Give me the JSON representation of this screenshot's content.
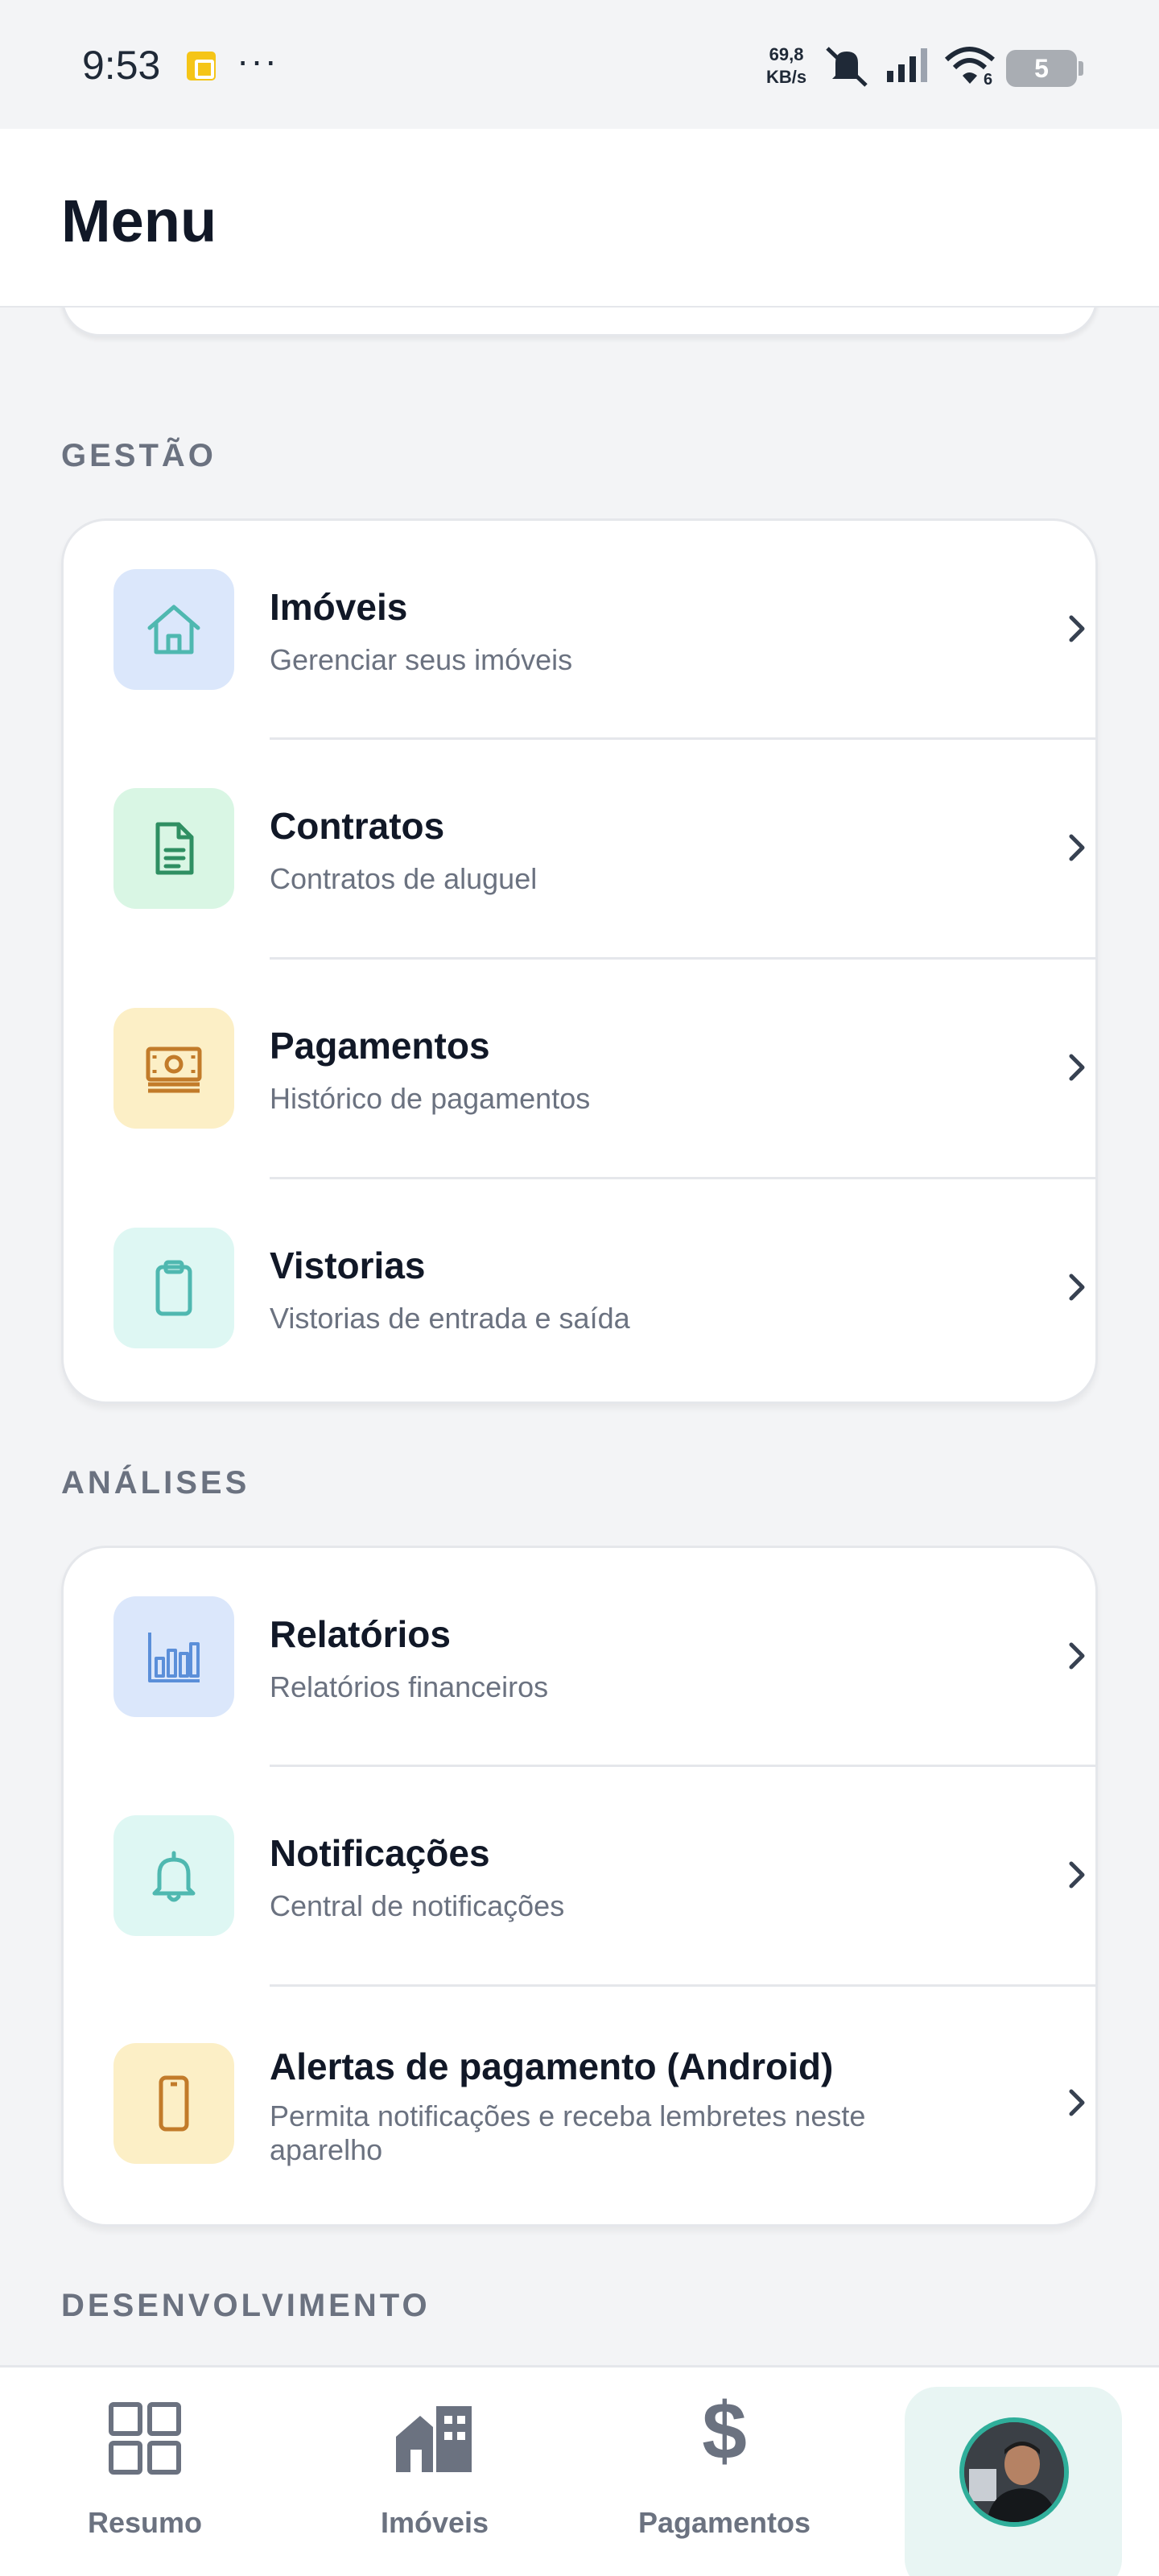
{
  "status_bar": {
    "time": "9:53",
    "speed_value": "69,8",
    "speed_unit": "KB/s",
    "wifi_badge": "6",
    "battery": "5"
  },
  "header": {
    "title": "Menu"
  },
  "sections": {
    "gestao": {
      "title": "GESTÃO",
      "items": [
        {
          "title": "Imóveis",
          "subtitle": "Gerenciar seus imóveis",
          "icon": "house-icon",
          "icon_bg": "#dbe7fb",
          "icon_color": "#4fb8b0"
        },
        {
          "title": "Contratos",
          "subtitle": "Contratos de aluguel",
          "icon": "document-icon",
          "icon_bg": "#d9f6e4",
          "icon_color": "#2f8f62"
        },
        {
          "title": "Pagamentos",
          "subtitle": "Histórico de pagamentos",
          "icon": "cash-icon",
          "icon_bg": "#fcefc6",
          "icon_color": "#c27b2a"
        },
        {
          "title": "Vistorias",
          "subtitle": "Vistorias de entrada e saída",
          "icon": "clipboard-icon",
          "icon_bg": "#def7f3",
          "icon_color": "#4fb8b0"
        }
      ]
    },
    "analises": {
      "title": "ANÁLISES",
      "items": [
        {
          "title": "Relatórios",
          "subtitle": "Relatórios financeiros",
          "icon": "bar-chart-icon",
          "icon_bg": "#dbe7fb",
          "icon_color": "#5b8fd9"
        },
        {
          "title": "Notificações",
          "subtitle": "Central de notificações",
          "icon": "bell-icon",
          "icon_bg": "#def7f3",
          "icon_color": "#4fb8b0"
        },
        {
          "title": "Alertas de pagamento (Android)",
          "subtitle": "Permita notificações e receba lembretes neste aparelho",
          "icon": "smartphone-icon",
          "icon_bg": "#fcefc6",
          "icon_color": "#c27b2a"
        }
      ]
    },
    "desenvolvimento": {
      "title": "DESENVOLVIMENTO"
    }
  },
  "bottom_nav": {
    "items": [
      {
        "label": "Resumo",
        "icon": "grid-icon"
      },
      {
        "label": "Imóveis",
        "icon": "buildings-icon"
      },
      {
        "label": "Pagamentos",
        "icon": "dollar-icon"
      },
      {
        "label": "",
        "icon": "avatar"
      }
    ],
    "active": 3,
    "accent": "#2fae9a"
  }
}
